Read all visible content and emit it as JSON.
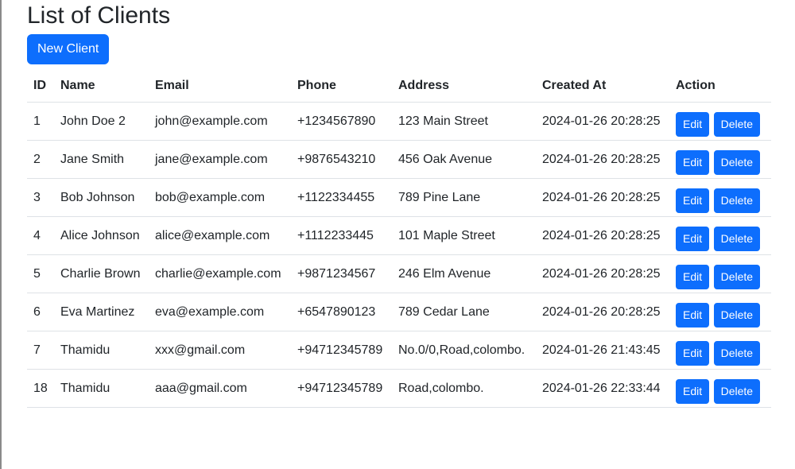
{
  "page": {
    "title": "List of Clients",
    "new_client_label": "New Client"
  },
  "table": {
    "headers": {
      "id": "ID",
      "name": "Name",
      "email": "Email",
      "phone": "Phone",
      "address": "Address",
      "created_at": "Created At",
      "action": "Action"
    },
    "rows": [
      {
        "id": "1",
        "name": "John Doe 2",
        "email": "john@example.com",
        "phone": "+1234567890",
        "address": "123 Main Street",
        "created_at": "2024-01-26 20:28:25",
        "edit": "Edit",
        "delete": "Delete"
      },
      {
        "id": "2",
        "name": "Jane Smith",
        "email": "jane@example.com",
        "phone": "+9876543210",
        "address": "456 Oak Avenue",
        "created_at": "2024-01-26 20:28:25",
        "edit": "Edit",
        "delete": "Delete"
      },
      {
        "id": "3",
        "name": "Bob Johnson",
        "email": "bob@example.com",
        "phone": "+1122334455",
        "address": "789 Pine Lane",
        "created_at": "2024-01-26 20:28:25",
        "edit": "Edit",
        "delete": "Delete"
      },
      {
        "id": "4",
        "name": "Alice Johnson",
        "email": "alice@example.com",
        "phone": "+1112233445",
        "address": "101 Maple Street",
        "created_at": "2024-01-26 20:28:25",
        "edit": "Edit",
        "delete": "Delete"
      },
      {
        "id": "5",
        "name": "Charlie Brown",
        "email": "charlie@example.com",
        "phone": "+9871234567",
        "address": "246 Elm Avenue",
        "created_at": "2024-01-26 20:28:25",
        "edit": "Edit",
        "delete": "Delete"
      },
      {
        "id": "6",
        "name": "Eva Martinez",
        "email": "eva@example.com",
        "phone": "+6547890123",
        "address": "789 Cedar Lane",
        "created_at": "2024-01-26 20:28:25",
        "edit": "Edit",
        "delete": "Delete"
      },
      {
        "id": "7",
        "name": "Thamidu",
        "email": "xxx@gmail.com",
        "phone": "+94712345789",
        "address": "No.0/0,Road,colombo.",
        "created_at": "2024-01-26 21:43:45",
        "edit": "Edit",
        "delete": "Delete"
      },
      {
        "id": "18",
        "name": "Thamidu",
        "email": "aaa@gmail.com",
        "phone": "+94712345789",
        "address": "Road,colombo.",
        "created_at": "2024-01-26 22:33:44",
        "edit": "Edit",
        "delete": "Delete"
      }
    ]
  },
  "colors": {
    "primary": "#0d6efd",
    "text": "#212529",
    "border": "#dee2e6"
  }
}
